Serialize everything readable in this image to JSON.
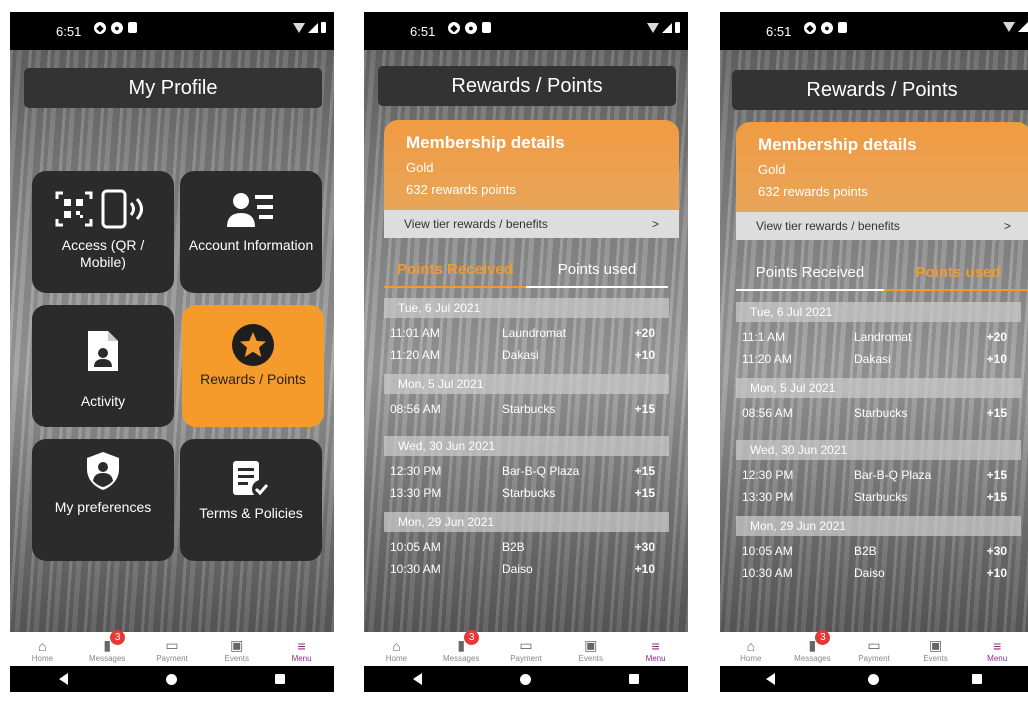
{
  "status": {
    "time": "6:51"
  },
  "nav": {
    "home": "Home",
    "messages": "Messages",
    "messages_badge": "3",
    "payment": "Payment",
    "events": "Events",
    "menu": "Menu"
  },
  "profile": {
    "title": "My Profile",
    "tiles": {
      "access": "Access  (QR / Mobile)",
      "account": "Account Information",
      "activity": "Activity",
      "rewards": "Rewards / Points",
      "preferences": "My preferences",
      "terms": "Terms & Policies"
    }
  },
  "rewards1": {
    "title": "Rewards / Points",
    "membership_title": "Membership details",
    "tier": "Gold",
    "points": "632 rewards points",
    "tier_link": "View tier rewards / benefits",
    "tier_link_arrow": ">",
    "tab_received": "Points Received",
    "tab_used": "Points used",
    "groups": [
      {
        "date": "Tue, 6 Jul 2021",
        "rows": [
          {
            "time": "11:01 AM",
            "merchant": "Laundromat",
            "points": "+20"
          },
          {
            "time": "11:20 AM",
            "merchant": "Dakasi",
            "points": "+10"
          }
        ]
      },
      {
        "date": "Mon, 5 Jul 2021",
        "rows": [
          {
            "time": "08:56 AM",
            "merchant": "Starbucks",
            "points": "+15"
          }
        ]
      },
      {
        "date": "Wed, 30 Jun 2021",
        "rows": [
          {
            "time": "12:30 PM",
            "merchant": "Bar-B-Q Plaza",
            "points": "+15"
          },
          {
            "time": "13:30 PM",
            "merchant": "Starbucks",
            "points": "+15"
          }
        ]
      },
      {
        "date": "Mon, 29 Jun 2021",
        "rows": [
          {
            "time": "10:05 AM",
            "merchant": "B2B",
            "points": "+30"
          },
          {
            "time": "10:30 AM",
            "merchant": "Daiso",
            "points": "+10"
          }
        ]
      }
    ]
  },
  "rewards2": {
    "title": "Rewards / Points",
    "membership_title": "Membership details",
    "tier": "Gold",
    "points": "632 rewards points",
    "tier_link": "View tier rewards / benefits",
    "tier_link_arrow": ">",
    "tab_received": "Points Received",
    "tab_used": "Points used",
    "groups": [
      {
        "date": "Tue, 6 Jul 2021",
        "rows": [
          {
            "time": "11:1 AM",
            "merchant": "Landromat",
            "points": "+20"
          },
          {
            "time": "11:20 AM",
            "merchant": "Dakasi",
            "points": "+10"
          }
        ]
      },
      {
        "date": "Mon, 5 Jul 2021",
        "rows": [
          {
            "time": "08:56 AM",
            "merchant": "Starbucks",
            "points": "+15"
          }
        ]
      },
      {
        "date": "Wed, 30 Jun 2021",
        "rows": [
          {
            "time": "12:30 PM",
            "merchant": "Bar-B-Q Plaza",
            "points": "+15"
          },
          {
            "time": "13:30 PM",
            "merchant": "Starbucks",
            "points": "+15"
          }
        ]
      },
      {
        "date": "Mon, 29 Jun 2021",
        "rows": [
          {
            "time": "10:05 AM",
            "merchant": "B2B",
            "points": "+30"
          },
          {
            "time": "10:30 AM",
            "merchant": "Daiso",
            "points": "+10"
          }
        ]
      }
    ]
  },
  "colors": {
    "accent": "#f59b2c",
    "menu_active": "#8e2a86",
    "badge": "#e53935"
  }
}
